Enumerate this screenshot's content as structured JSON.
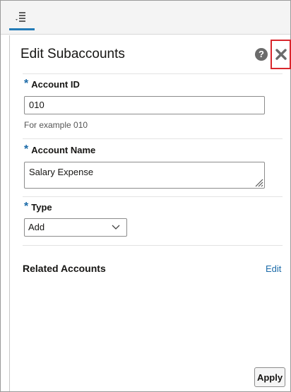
{
  "icons": {
    "tab": "list-menu-icon",
    "help": "help-icon",
    "close": "close-icon",
    "dropdown": "chevron-down-icon",
    "resize": "resize-grip-icon"
  },
  "colors": {
    "accent": "#227bb7",
    "required": "#1b6aa8",
    "link": "#1b6aa8",
    "highlight": "#d9262c"
  },
  "panel": {
    "title": "Edit Subaccounts",
    "help_label": "?"
  },
  "form": {
    "required_marker": "*",
    "account_id": {
      "label": "Account ID",
      "value": "010",
      "hint": "For example 010"
    },
    "account_name": {
      "label": "Account Name",
      "value": "Salary Expense"
    },
    "type": {
      "label": "Type",
      "value": "Add"
    }
  },
  "related": {
    "title": "Related Accounts",
    "edit_label": "Edit"
  },
  "footer": {
    "apply_label": "Apply"
  }
}
